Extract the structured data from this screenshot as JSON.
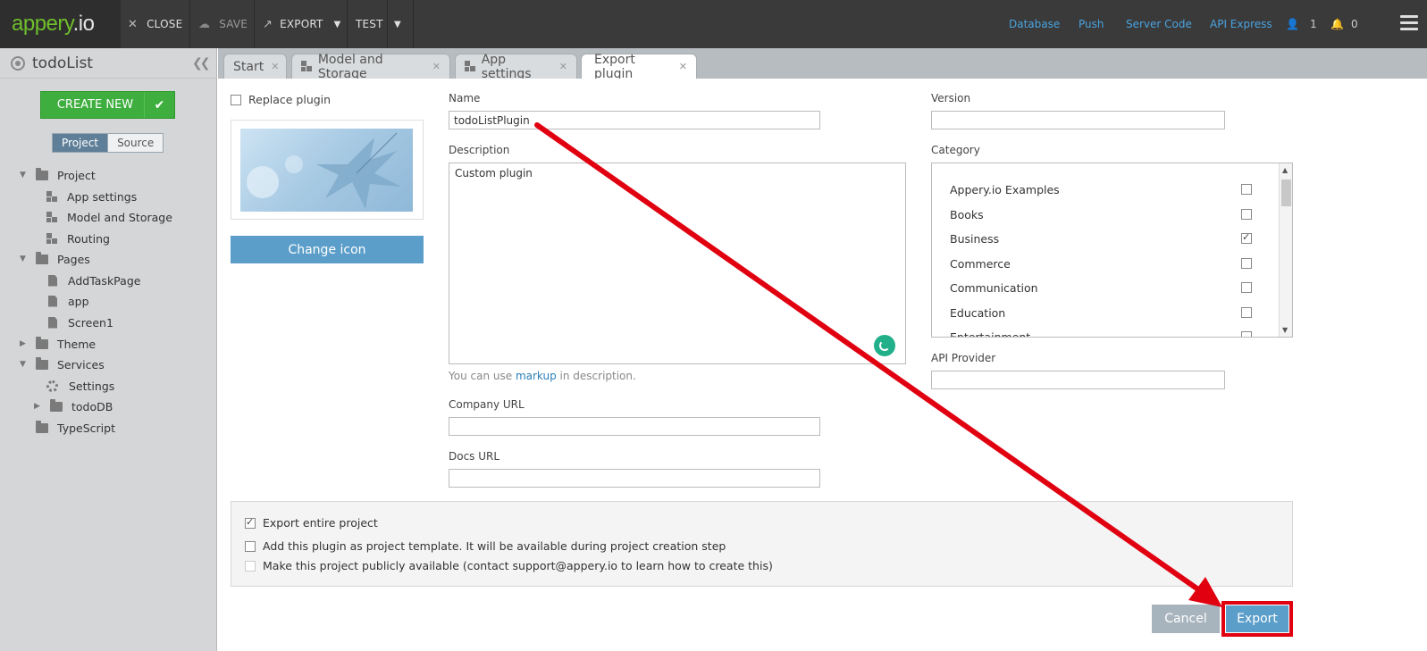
{
  "topbar": {
    "logo_brand": "appery",
    "logo_tld": ".io",
    "close_label": "CLOSE",
    "save_label": "SAVE",
    "export_label": "EXPORT",
    "test_label": "TEST",
    "links": [
      "Database",
      "Push",
      "Server Code",
      "API Express"
    ],
    "user_count": "1",
    "notif_count": "0"
  },
  "sidebar": {
    "project_title": "todoList",
    "create_new_label": "CREATE NEW",
    "seg_project": "Project",
    "seg_source": "Source",
    "tree": {
      "project": "Project",
      "app_settings": "App settings",
      "model_storage": "Model and Storage",
      "routing": "Routing",
      "pages": "Pages",
      "add_task_page": "AddTaskPage",
      "app": "app",
      "screen1": "Screen1",
      "theme": "Theme",
      "services": "Services",
      "settings": "Settings",
      "tododb": "todoDB",
      "typescript": "TypeScript"
    }
  },
  "tabs": {
    "start": "Start",
    "model_storage": "Model and Storage",
    "app_settings": "App settings",
    "export_plugin": "Export plugin"
  },
  "form": {
    "replace_plugin_label": "Replace plugin",
    "change_icon_label": "Change icon",
    "name_label": "Name",
    "name_value": "todoListPlugin",
    "description_label": "Description",
    "description_value": "Custom plugin",
    "hint_prefix": "You can use ",
    "hint_link": "markup",
    "hint_suffix": " in description.",
    "company_url_label": "Company URL",
    "company_url_value": "",
    "docs_url_label": "Docs URL",
    "docs_url_value": "",
    "version_label": "Version",
    "version_value": "",
    "category_label": "Category",
    "categories": [
      {
        "name": "Appery.io Examples",
        "checked": false
      },
      {
        "name": "Books",
        "checked": false
      },
      {
        "name": "Business",
        "checked": true
      },
      {
        "name": "Commerce",
        "checked": false
      },
      {
        "name": "Communication",
        "checked": false
      },
      {
        "name": "Education",
        "checked": false
      },
      {
        "name": "Entertainment",
        "checked": false
      }
    ],
    "api_provider_label": "API Provider",
    "api_provider_value": "",
    "export_entire_label": "Export entire project",
    "export_entire_checked": true,
    "template_label": "Add this plugin as project template. It will be available during project creation step",
    "template_checked": false,
    "public_label": "Make this project publicly available (contact support@appery.io to learn how to create this)",
    "public_checked": false,
    "cancel_label": "Cancel",
    "export_label": "Export"
  },
  "colors": {
    "brand_green": "#6fbf2c",
    "link_blue": "#4aa3df",
    "button_blue": "#5b9ec9",
    "annotation_red": "#e10010"
  }
}
